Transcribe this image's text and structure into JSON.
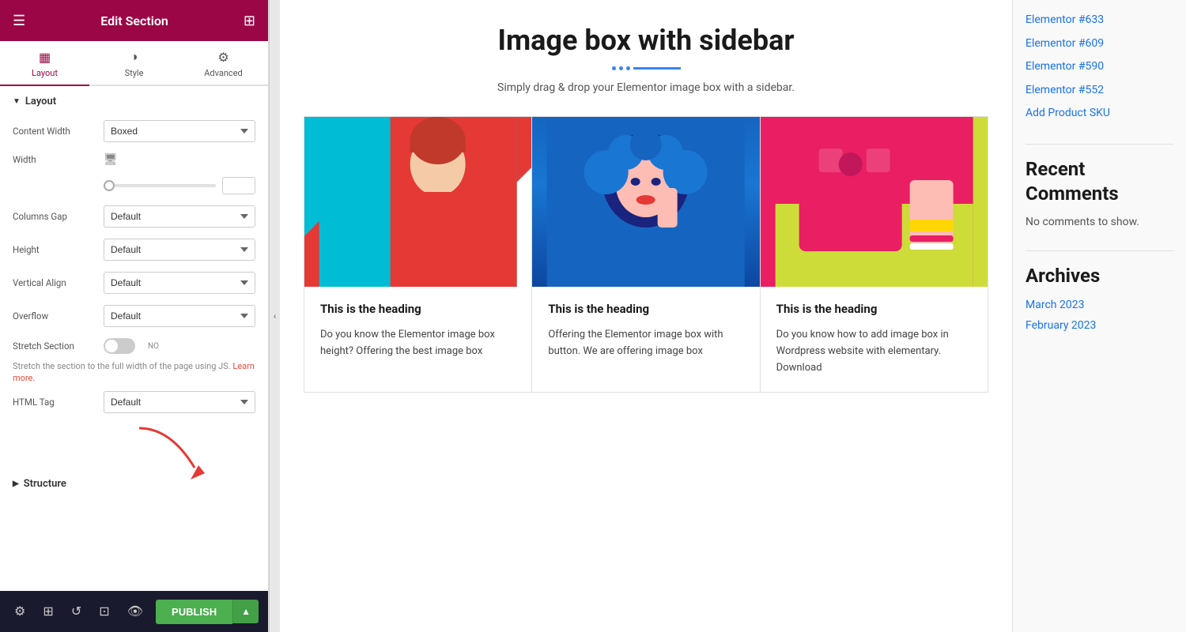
{
  "panel": {
    "title": "Edit Section",
    "tabs": [
      {
        "id": "layout",
        "label": "Layout",
        "icon": "▦",
        "active": true
      },
      {
        "id": "style",
        "label": "Style",
        "icon": "◑"
      },
      {
        "id": "advanced",
        "label": "Advanced",
        "icon": "⚙"
      }
    ],
    "layout_section_label": "Layout",
    "fields": {
      "content_width_label": "Content Width",
      "content_width_value": "Boxed",
      "width_label": "Width",
      "columns_gap_label": "Columns Gap",
      "columns_gap_value": "Default",
      "height_label": "Height",
      "height_value": "Default",
      "vertical_align_label": "Vertical Align",
      "vertical_align_value": "Default",
      "overflow_label": "Overflow",
      "overflow_value": "Default",
      "stretch_section_label": "Stretch Section",
      "stretch_hint": "Stretch the section to the full width of the page using JS.",
      "learn_more": "Learn more.",
      "html_tag_label": "HTML Tag",
      "html_tag_value": "Default"
    },
    "structure_label": "Structure",
    "footer": {
      "publish_label": "PUBLISH"
    }
  },
  "main": {
    "title": "Image box with sidebar",
    "subtitle": "Simply drag & drop your Elementor image box with a sidebar.",
    "boxes": [
      {
        "heading": "This is the heading",
        "text": "Do you know the Elementor image box height? Offering the best image box"
      },
      {
        "heading": "This is the heading",
        "text": "Offering the Elementor image box with button. We are offering image box"
      },
      {
        "heading": "This is the heading",
        "text": "Do you know how to add image box in Wordpress website with elementary. Download"
      }
    ]
  },
  "sidebar": {
    "links": [
      {
        "label": "Elementor #633"
      },
      {
        "label": "Elementor #609"
      },
      {
        "label": "Elementor #590"
      },
      {
        "label": "Elementor #552"
      },
      {
        "label": "Add Product SKU"
      }
    ],
    "recent_comments_title": "Recent Comments",
    "no_comments": "No comments to show.",
    "archives_title": "Archives",
    "archive_links": [
      {
        "label": "March 2023"
      },
      {
        "label": "February 2023"
      }
    ]
  }
}
